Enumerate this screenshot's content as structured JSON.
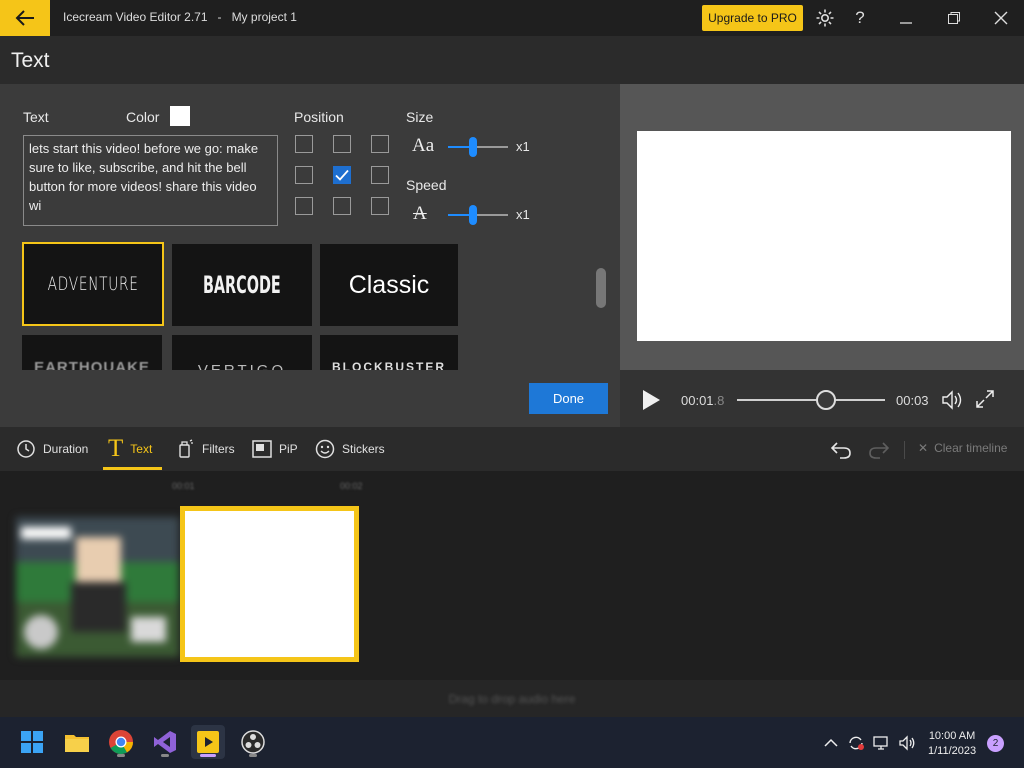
{
  "window": {
    "app_name": "Icecream Video Editor 2.71",
    "separator": "-",
    "project": "My project 1",
    "upgrade_label": "Upgrade to PRO"
  },
  "page": {
    "title": "Text"
  },
  "editor": {
    "text_label": "Text",
    "color_label": "Color",
    "text_color": "#ffffff",
    "text_value": "lets start this video! before we go: make sure to like, subscribe, and hit the bell button for more videos! share this video wi",
    "position_label": "Position",
    "position_selected": "middle-center",
    "size_label": "Size",
    "size_value": "x1",
    "speed_label": "Speed",
    "speed_value": "x1",
    "styles": [
      "ADVENTURE",
      "BARCODE",
      "Classic",
      "EARTHQUAKE",
      "VERTIGO",
      "BLOCKBUSTER"
    ],
    "selected_style": "ADVENTURE",
    "done_label": "Done"
  },
  "player": {
    "current_time_main": "00:01",
    "current_time_frac": ".8",
    "total_time": "00:03",
    "progress": 0.6
  },
  "tools": {
    "items": [
      "Duration",
      "Text",
      "Filters",
      "PiP",
      "Stickers"
    ],
    "active": "Text",
    "clear_label": "Clear timeline"
  },
  "timeline": {
    "ruler": [
      "00:01",
      "00:02"
    ],
    "audio_hint": "Drag to drop audio here"
  },
  "taskbar": {
    "apps": [
      "windows-start",
      "file-explorer",
      "chrome",
      "visual-studio",
      "icecream-video-editor",
      "obs-studio"
    ],
    "active_app": "icecream-video-editor",
    "time": "10:00 AM",
    "date": "1/11/2023",
    "notifications": "2"
  },
  "colors": {
    "accent": "#f5c518",
    "primary": "#1e78d7",
    "panel": "#3b3b3b"
  }
}
